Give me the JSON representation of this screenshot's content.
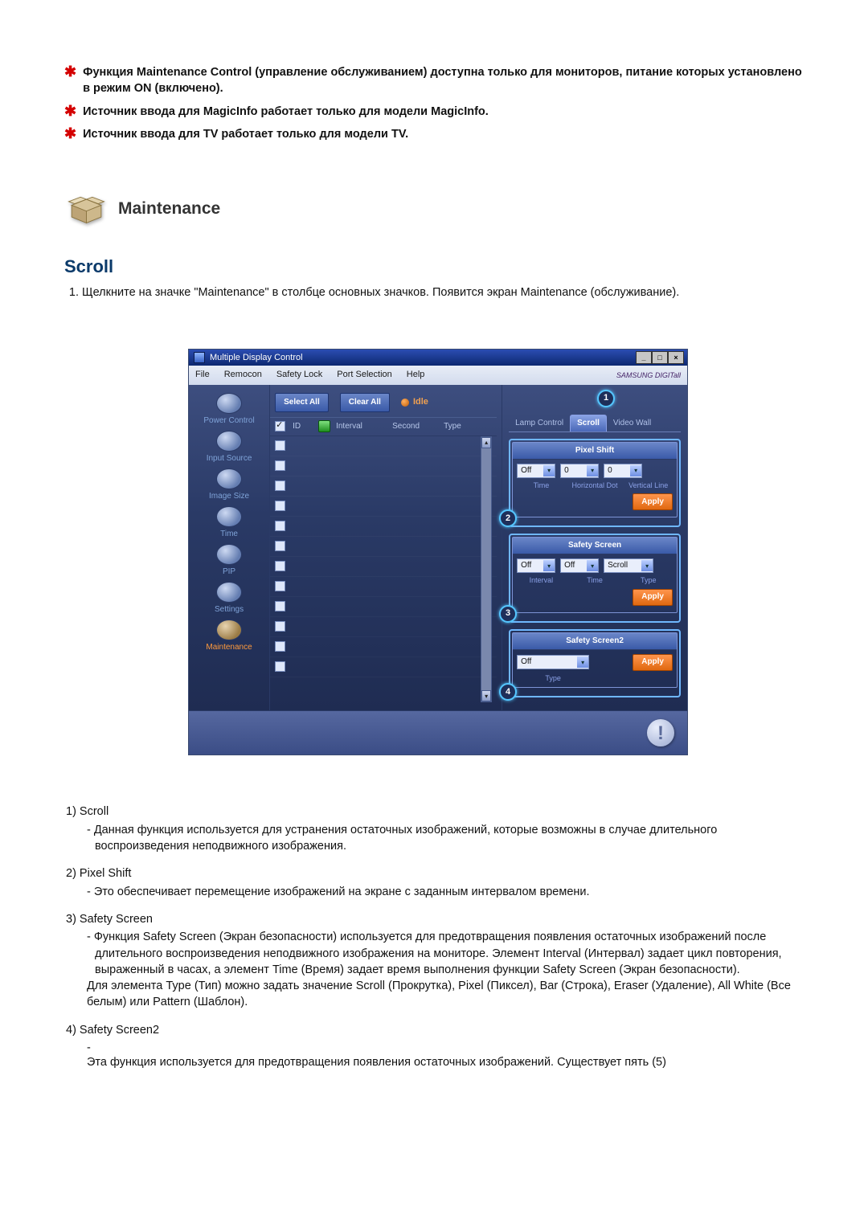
{
  "notes": {
    "n1": "Функция Maintenance Control (управление обслуживанием) доступна только для мониторов, питание которых установлено в режим ON (включено).",
    "n2": "Источник ввода для MagicInfo работает только для модели MagicInfo.",
    "n3": "Источник ввода для TV работает только для модели TV."
  },
  "maintenance_heading": "Maintenance",
  "scroll_heading": "Scroll",
  "steps": {
    "s1": "Щелкните на значке \"Maintenance\" в столбце основных значков. Появится экран Maintenance (обслуживание)."
  },
  "screenshot": {
    "window_title": "Multiple Display Control",
    "menu": {
      "m1": "File",
      "m2": "Remocon",
      "m3": "Safety Lock",
      "m4": "Port Selection",
      "m5": "Help"
    },
    "brand": "SAMSUNG DIGITall",
    "sidebar": {
      "i1": "Power Control",
      "i2": "Input Source",
      "i3": "Image Size",
      "i4": "Time",
      "i5": "PIP",
      "i6": "Settings",
      "i7": "Maintenance"
    },
    "toolbar": {
      "select_all": "Select All",
      "clear_all": "Clear All",
      "idle": "Idle"
    },
    "columns": {
      "c_id": "ID",
      "c_interval": "Interval",
      "c_second": "Second",
      "c_type": "Type"
    },
    "tabs": {
      "t1": "Lamp Control",
      "t2": "Scroll",
      "t3": "Video Wall"
    },
    "pixel_shift": {
      "title": "Pixel Shift",
      "sel": "Off",
      "v_h": "0",
      "v_v": "0",
      "l_time": "Time",
      "l_h": "Horizontal Dot",
      "l_v": "Vertical Line",
      "apply": "Apply"
    },
    "safety_screen": {
      "title": "Safety Screen",
      "interval": "Off",
      "time": "Off",
      "type": "Scroll",
      "l_interval": "Interval",
      "l_time": "Time",
      "l_type": "Type",
      "apply": "Apply"
    },
    "safety_screen2": {
      "title": "Safety Screen2",
      "type": "Off",
      "l_type": "Type",
      "apply": "Apply"
    },
    "callouts": {
      "c1": "1",
      "c2": "2",
      "c3": "3",
      "c4": "4"
    }
  },
  "desc": {
    "d1_label": "1)  Scroll",
    "d1_body": "- Данная функция используется для устранения остаточных изображений, которые возможны в случае длительного воспроизведения неподвижного изображения.",
    "d2_label": "2)  Pixel Shift",
    "d2_body": "- Это обеспечивает перемещение изображений на экране с заданным интервалом времени.",
    "d3_label": "3)  Safety Screen",
    "d3_body": "- Функция Safety Screen (Экран безопасности) используется для предотвращения появления остаточных изображений после длительного воспроизведения неподвижного изображения на мониторе. Элемент Interval (Интервал) задает цикл повторения, выраженный в часах, а элемент Time (Время) задает время выполнения функции Safety Screen (Экран безопасности).",
    "d3_body2": "Для элемента Type (Тип) можно задать значение Scroll (Прокрутка), Pixel (Пиксел), Bar (Строка), Eraser (Удаление), All White (Все белым) или Pattern (Шаблон).",
    "d4_label": "4)  Safety Screen2",
    "d4_dash": "-",
    "d4_body": "Эта функция используется для предотвращения появления остаточных изображений. Существует пять (5)"
  }
}
